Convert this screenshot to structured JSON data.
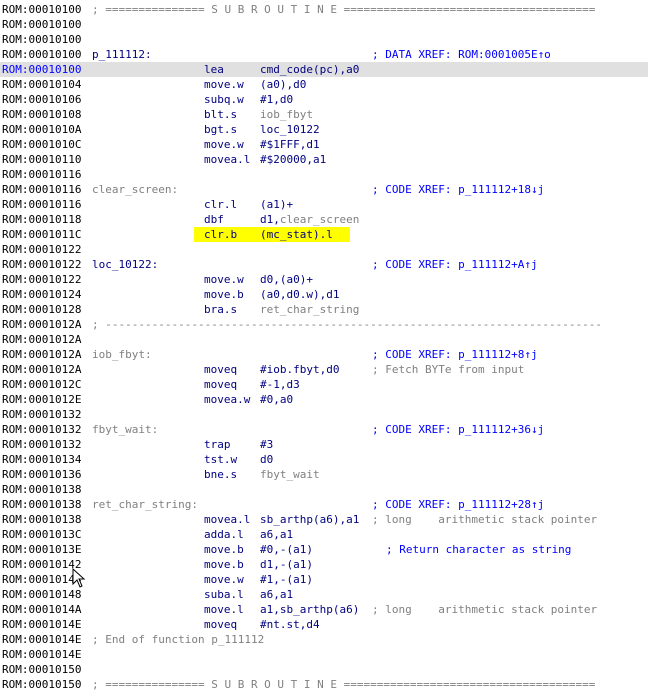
{
  "listing": {
    "lines": [
      {
        "addr": "ROM:00010100",
        "sep": "; =============== S U B R O U T I N E ======================================"
      },
      {
        "addr": "ROM:00010100"
      },
      {
        "addr": "ROM:00010100"
      },
      {
        "addr": "ROM:00010100",
        "label": "p_111112:",
        "label_kind": "def",
        "comment": "; DATA XREF: ROM:0001005E↑o",
        "comment_col": 372,
        "comment_kind": "xref"
      },
      {
        "addr": "ROM:00010100",
        "cursor": true,
        "mnem": "lea",
        "ops": [
          {
            "t": "cmd_code(pc)",
            "k": "n"
          },
          {
            "t": ",a0",
            "k": "n"
          }
        ]
      },
      {
        "addr": "ROM:00010104",
        "mnem": "move.w",
        "ops": [
          {
            "t": "(a0),d0",
            "k": "n"
          }
        ]
      },
      {
        "addr": "ROM:00010106",
        "mnem": "subq.w",
        "ops": [
          {
            "t": "#1,d0",
            "k": "n"
          }
        ]
      },
      {
        "addr": "ROM:00010108",
        "mnem": "blt.s",
        "ops": [
          {
            "t": "iob_fbyt",
            "k": "g"
          }
        ]
      },
      {
        "addr": "ROM:0001010A",
        "mnem": "bgt.s",
        "ops": [
          {
            "t": "loc_10122",
            "k": "n"
          }
        ]
      },
      {
        "addr": "ROM:0001010C",
        "mnem": "move.w",
        "ops": [
          {
            "t": "#$1FFF,d1",
            "k": "n"
          }
        ]
      },
      {
        "addr": "ROM:00010110",
        "mnem": "movea.l",
        "ops": [
          {
            "t": "#$20000,a1",
            "k": "n"
          }
        ]
      },
      {
        "addr": "ROM:00010116"
      },
      {
        "addr": "ROM:00010116",
        "label": "clear_screen:",
        "label_kind": "loc",
        "comment": "; CODE XREF: p_111112+18↓j",
        "comment_col": 372,
        "comment_kind": "xref"
      },
      {
        "addr": "ROM:00010116",
        "mnem": "clr.l",
        "ops": [
          {
            "t": "(a1)+",
            "k": "n"
          }
        ]
      },
      {
        "addr": "ROM:00010118",
        "mnem": "dbf",
        "ops": [
          {
            "t": "d1,",
            "k": "n"
          },
          {
            "t": "clear_screen",
            "k": "g"
          }
        ]
      },
      {
        "addr": "ROM:0001011C",
        "highlight": true,
        "mnem": "clr.b",
        "ops": [
          {
            "t": "(mc_stat).l",
            "k": "n"
          }
        ]
      },
      {
        "addr": "ROM:00010122"
      },
      {
        "addr": "ROM:00010122",
        "label": "loc_10122:",
        "label_kind": "def",
        "comment": "; CODE XREF: p_111112+A↑j",
        "comment_col": 372,
        "comment_kind": "xref"
      },
      {
        "addr": "ROM:00010122",
        "mnem": "move.w",
        "ops": [
          {
            "t": "d0,(a0)+",
            "k": "n"
          }
        ]
      },
      {
        "addr": "ROM:00010124",
        "mnem": "move.b",
        "ops": [
          {
            "t": "(a0,d0.w),d1",
            "k": "n"
          }
        ]
      },
      {
        "addr": "ROM:00010128",
        "mnem": "bra.s",
        "ops": [
          {
            "t": "ret_char_string",
            "k": "g"
          }
        ]
      },
      {
        "addr": "ROM:0001012A",
        "sep": "; ---------------------------------------------------------------------------"
      },
      {
        "addr": "ROM:0001012A"
      },
      {
        "addr": "ROM:0001012A",
        "label": "iob_fbyt:",
        "label_kind": "loc",
        "comment": "; CODE XREF: p_111112+8↑j",
        "comment_col": 372,
        "comment_kind": "xref"
      },
      {
        "addr": "ROM:0001012A",
        "mnem": "moveq",
        "ops": [
          {
            "t": "#iob.fbyt,d0",
            "k": "n"
          }
        ],
        "comment": "; Fetch BYTe from input",
        "comment_col": 372,
        "comment_kind": "plain"
      },
      {
        "addr": "ROM:0001012C",
        "mnem": "moveq",
        "ops": [
          {
            "t": "#-1,d3",
            "k": "n"
          }
        ]
      },
      {
        "addr": "ROM:0001012E",
        "mnem": "movea.w",
        "ops": [
          {
            "t": "#0,a0",
            "k": "n"
          }
        ]
      },
      {
        "addr": "ROM:00010132"
      },
      {
        "addr": "ROM:00010132",
        "label": "fbyt_wait:",
        "label_kind": "loc",
        "comment": "; CODE XREF: p_111112+36↓j",
        "comment_col": 372,
        "comment_kind": "xref"
      },
      {
        "addr": "ROM:00010132",
        "mnem": "trap",
        "ops": [
          {
            "t": "#3",
            "k": "n"
          }
        ]
      },
      {
        "addr": "ROM:00010134",
        "mnem": "tst.w",
        "ops": [
          {
            "t": "d0",
            "k": "n"
          }
        ]
      },
      {
        "addr": "ROM:00010136",
        "mnem": "bne.s",
        "ops": [
          {
            "t": "fbyt_wait",
            "k": "g"
          }
        ]
      },
      {
        "addr": "ROM:00010138"
      },
      {
        "addr": "ROM:00010138",
        "label": "ret_char_string:",
        "label_kind": "loc",
        "comment": "; CODE XREF: p_111112+28↑j",
        "comment_col": 372,
        "comment_kind": "xref"
      },
      {
        "addr": "ROM:00010138",
        "mnem": "movea.l",
        "ops": [
          {
            "t": "sb_arthp(a6),a1",
            "k": "n"
          }
        ],
        "comment": "; long    arithmetic stack pointer",
        "comment_col": 372,
        "comment_kind": "plain"
      },
      {
        "addr": "ROM:0001013C",
        "mnem": "adda.l",
        "ops": [
          {
            "t": "a6,a1",
            "k": "n"
          }
        ]
      },
      {
        "addr": "ROM:0001013E",
        "mnem": "move.b",
        "ops": [
          {
            "t": "#0,-(a1)",
            "k": "n"
          }
        ],
        "comment": "; Return character as string",
        "comment_col": 386,
        "comment_kind": "hi"
      },
      {
        "addr": "ROM:00010142",
        "mnem": "move.b",
        "ops": [
          {
            "t": "d1,-(a1)",
            "k": "n"
          }
        ]
      },
      {
        "addr": "ROM:00010144",
        "mnem": "move.w",
        "ops": [
          {
            "t": "#1,-(a1)",
            "k": "n"
          }
        ]
      },
      {
        "addr": "ROM:00010148",
        "mnem": "suba.l",
        "ops": [
          {
            "t": "a6,a1",
            "k": "n"
          }
        ]
      },
      {
        "addr": "ROM:0001014A",
        "mnem": "move.l",
        "ops": [
          {
            "t": "a1,sb_arthp(a6)",
            "k": "n"
          }
        ],
        "comment": "; long    arithmetic stack pointer",
        "comment_col": 372,
        "comment_kind": "plain"
      },
      {
        "addr": "ROM:0001014E",
        "mnem": "moveq",
        "ops": [
          {
            "t": "#nt.st,d4",
            "k": "n"
          }
        ]
      },
      {
        "addr": "ROM:0001014E",
        "sep": "; End of function p_111112"
      },
      {
        "addr": "ROM:0001014E"
      },
      {
        "addr": "ROM:00010150"
      },
      {
        "addr": "ROM:00010150",
        "sep": "; =============== S U B R O U T I N E ======================================"
      }
    ]
  }
}
